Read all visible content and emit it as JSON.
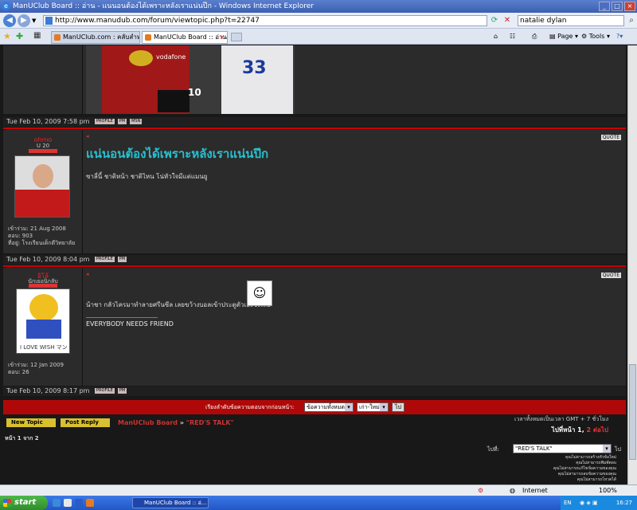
{
  "window": {
    "title": "ManUClub Board :: อ่าน - แนนอนต้องได้เพราะหลังเราแน่นปึก - Windows Internet Explorer"
  },
  "address": {
    "url": "http://www.manudub.com/forum/viewtopic.php?t=22747",
    "search_value": "natalie dylan"
  },
  "tabs": [
    {
      "label": "ManUClub.com : คลับสำหรับแ..."
    },
    {
      "label": "ManUClub Board :: อ่าน - ..."
    }
  ],
  "toolbar": {
    "page_label": "Page",
    "tools_label": "Tools"
  },
  "posts": [
    {
      "footer_time": "Tue Feb 10, 2009 7:58 pm",
      "shirt_number": "10",
      "jersey_number": "33",
      "sponsor": "vodafone"
    },
    {
      "username": "ohmo",
      "rank": "U 20",
      "title": "แน่นอนต้องได้เพราะหลังเราแน่นปึก",
      "body": "ซาลี่นี้ ชาติหน้า ชาติไหน โน่หัวใจมีแต่แมนยู",
      "joined": "เข้าร่วม: 21 Aug 2008",
      "posts": "ตอบ: 903",
      "location": "ที่อยู่: โรงเรียนเด็กดีวิทยาลัย",
      "footer_time": "Tue Feb 10, 2009 8:04 pm"
    },
    {
      "username": "อิโล้",
      "rank": "นักเยอนิกลับ",
      "body": "น้าชา กลัวไครมาทำลายศรีนซีล เลยขว้างบอลเข้าประตูตัวเองซะเลย",
      "signature": "EVERYBODY NEEDS FRIEND",
      "avatar_text": "I LOVE WISH マン",
      "joined": "เข้าร่วม: 12 Jan 2009",
      "posts": "ตอบ: 26",
      "footer_time": "Tue Feb 10, 2009 8:17 pm"
    }
  ],
  "sort_bar": {
    "label": "เรียงลำดับข้อความตอบจากก่อนหน้า:",
    "select1": "ข้อความทั้งหมด",
    "select2": "เก่า-ใหม่",
    "go": "ไป"
  },
  "actions": {
    "new_topic": "New Topic",
    "post_reply": "Post Reply"
  },
  "breadcrumb": {
    "board": "ManUClub Board",
    "forum": "\"RED'S TALK\""
  },
  "timezone": "เวลาทั้งหมดเป็นเวลา GMT + 7 ชั่วโมง",
  "pager": {
    "prefix": "ไปที่หน้า",
    "current": "1",
    "page2": "2",
    "next": "ต่อไป"
  },
  "page_count": "หน้า 1 จาก 2",
  "jump": {
    "label": "ไปที่:",
    "value": "\"RED'S TALK\"",
    "go": "ไป"
  },
  "permissions": [
    "คุณไม่สามารถสร้างหัวข้อใหม่",
    "คุณไม่สามารถพิมพ์ตอบ",
    "คุณไม่สามารถแก้ไขข้อความของคุณ",
    "คุณไม่สามารถลบข้อความของคุณ",
    "คุณไม่สามารถโหวตได้"
  ],
  "status": {
    "zone": "Internet",
    "zoom": "100%"
  },
  "taskbar": {
    "start": "start",
    "task": "ManUClub Board :: อ่...",
    "lang": "EN",
    "clock": "16:27"
  }
}
